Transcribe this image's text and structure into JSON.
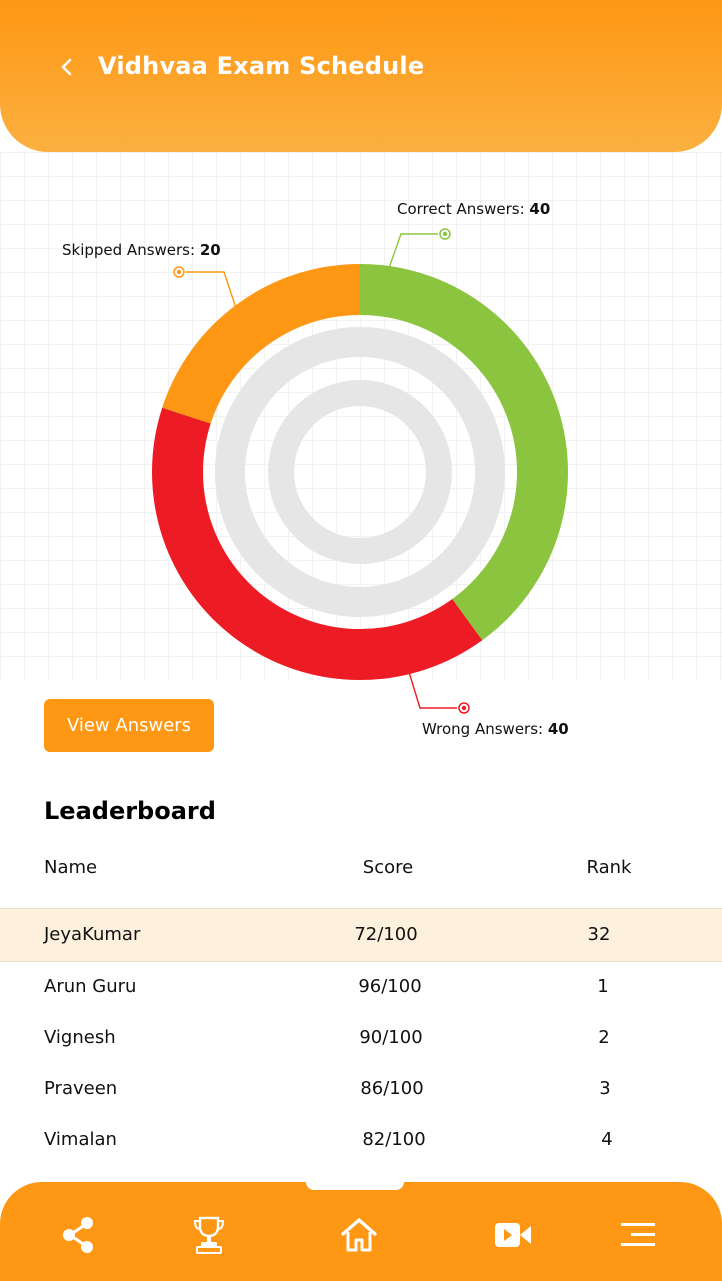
{
  "header": {
    "title": "Vidhvaa Exam Schedule",
    "back_icon": "chevron-left-icon"
  },
  "chart_data": {
    "type": "pie",
    "variant": "donut",
    "categories": [
      "Correct Answers",
      "Wrong Answers",
      "Skipped Answers"
    ],
    "values": [
      40,
      40,
      20
    ],
    "colors": [
      "#8bc540",
      "#ed1c24",
      "#fe9713"
    ],
    "labels": {
      "correct": {
        "prefix": "Correct Answers: ",
        "value": "40"
      },
      "wrong": {
        "prefix": "Wrong Answers: ",
        "value": "40"
      },
      "skipped": {
        "prefix": "Skipped Answers: ",
        "value": "20"
      }
    }
  },
  "actions": {
    "view_answers": "View Answers"
  },
  "leaderboard": {
    "title": "Leaderboard",
    "columns": {
      "name": "Name",
      "score": "Score",
      "rank": "Rank"
    },
    "rows": [
      {
        "name": "JeyaKumar",
        "score": "72/100",
        "rank": "32"
      },
      {
        "name": "Arun Guru",
        "score": "96/100",
        "rank": "1"
      },
      {
        "name": "Vignesh",
        "score": "90/100",
        "rank": "2"
      },
      {
        "name": "Praveen",
        "score": "86/100",
        "rank": "3"
      },
      {
        "name": "Vimalan",
        "score": "82/100",
        "rank": "4"
      }
    ]
  },
  "nav": {
    "accent": "#fe9713",
    "items": [
      "share-icon",
      "trophy-icon",
      "home-icon",
      "video-camera-icon",
      "menu-icon"
    ]
  }
}
